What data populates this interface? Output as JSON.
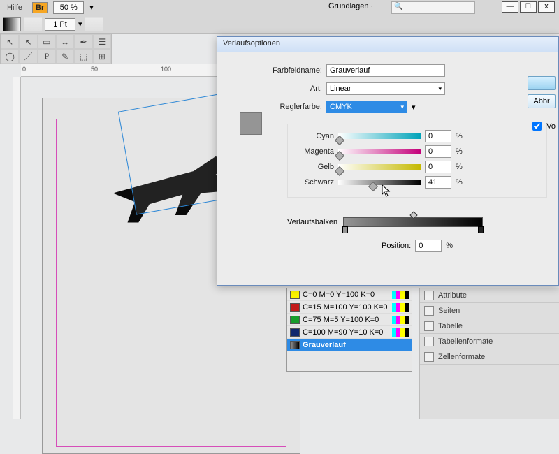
{
  "top": {
    "help": "Hilfe",
    "br": "Br",
    "zoom": "50 %",
    "stroke": "1 Pt",
    "workspace": "Grundlagen"
  },
  "ruler": {
    "r0": "0",
    "r50": "50",
    "r100": "100"
  },
  "dialog": {
    "title": "Verlaufsoptionen",
    "name_label": "Farbfeldname:",
    "name_value": "Grauverlauf",
    "type_label": "Art:",
    "type_value": "Linear",
    "stopcolor_label": "Reglerfarbe:",
    "stopcolor_value": "CMYK",
    "sliders": {
      "cyan_label": "Cyan",
      "cyan_val": "0",
      "magenta_label": "Magenta",
      "magenta_val": "0",
      "yellow_label": "Gelb",
      "yellow_val": "0",
      "black_label": "Schwarz",
      "black_val": "41"
    },
    "vb_label": "Verlaufsbalken",
    "pos_label": "Position:",
    "pos_val": "0",
    "pct": "%",
    "cancel": "Abbr",
    "preview": "Vo"
  },
  "swatches": {
    "r0": "C=0 M=0 Y=100 K=0",
    "r1": "C=15 M=100 Y=100 K=0",
    "r2": "C=75 M=5 Y=100 K=0",
    "r3": "C=100 M=90 Y=10 K=0",
    "r4": "Grauverlauf"
  },
  "panels": {
    "attr": "Attribute",
    "pages": "Seiten",
    "table": "Tabelle",
    "tablefmt": "Tabellenformate",
    "cellfmt": "Zellenformate"
  }
}
